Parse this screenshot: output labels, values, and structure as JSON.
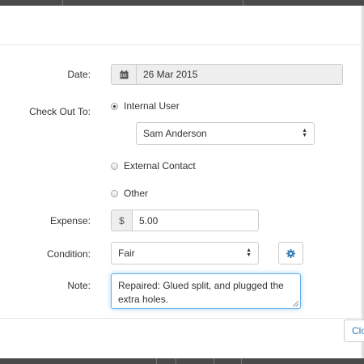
{
  "form": {
    "date": {
      "label": "Date:",
      "value": "26 Mar 2015",
      "icon": "calendar-icon"
    },
    "check_out_to": {
      "label": "Check Out To:",
      "options": [
        {
          "label": "Internal User",
          "checked": true
        },
        {
          "label": "External Contact",
          "checked": false
        },
        {
          "label": "Other",
          "checked": false
        }
      ],
      "user_selected": "Sam Anderson"
    },
    "expense": {
      "label": "Expense:",
      "currency": "$",
      "value": "5.00"
    },
    "condition": {
      "label": "Condition:",
      "selected": "Fair",
      "settings_icon": "gear-icon"
    },
    "note": {
      "label": "Note:",
      "value": "Repaired: Glued split, and plugged the extra holes."
    }
  },
  "footer": {
    "close_label": "Close"
  },
  "colors": {
    "link_blue": "#337ab7",
    "focus_border": "#66afe9"
  }
}
